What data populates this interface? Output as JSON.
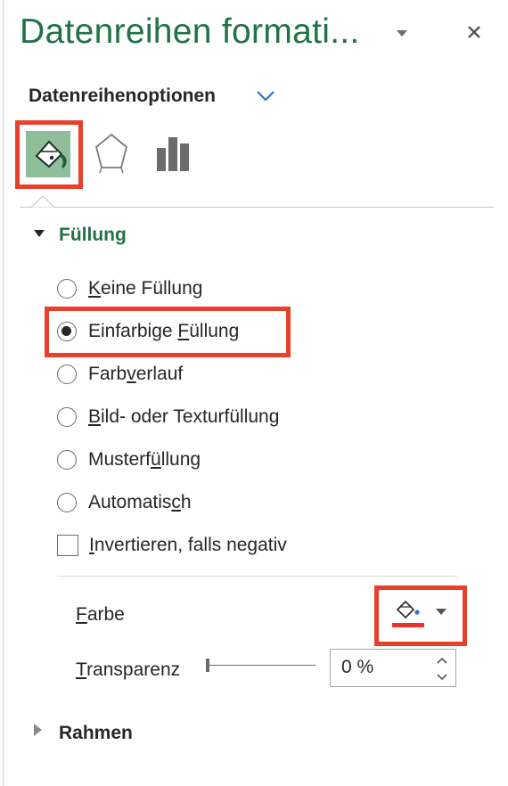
{
  "pane": {
    "title": "Datenreihen formati...",
    "dropdown_icon": "caret-down-icon",
    "close_icon": "close-icon"
  },
  "series_options": {
    "label": "Datenreihenoptionen",
    "chevron_icon": "chevron-down-icon"
  },
  "tabs": [
    {
      "name": "fill-line-tab",
      "icon": "paint-bucket-icon",
      "selected": true
    },
    {
      "name": "effects-tab",
      "icon": "pentagon-icon",
      "selected": false
    },
    {
      "name": "series-options-tab",
      "icon": "bar-chart-icon",
      "selected": false
    }
  ],
  "fill_section": {
    "title": "Füllung",
    "expanded": true,
    "options": {
      "no_fill": {
        "pre": "",
        "accel": "K",
        "post": "eine Füllung",
        "checked": false
      },
      "solid": {
        "pre": "Einfarbige ",
        "accel": "F",
        "post": "üllung",
        "checked": true
      },
      "gradient": {
        "pre": "Farb",
        "accel": "v",
        "post": "erlauf",
        "checked": false
      },
      "picture": {
        "pre": "",
        "accel": "B",
        "post": "ild- oder Texturfüllung",
        "checked": false
      },
      "pattern": {
        "pre": "Musterf",
        "accel": "ü",
        "post": "llung",
        "checked": false
      },
      "automatic": {
        "pre": "Automatis",
        "accel": "c",
        "post": "h",
        "checked": false
      }
    },
    "invert": {
      "pre": "",
      "accel": "I",
      "post": "nvertieren, falls negativ",
      "checked": false
    },
    "color": {
      "pre": "",
      "accel": "F",
      "post": "arbe",
      "swatch": "#e8322a",
      "icon": "paint-bucket-icon",
      "dropdown_icon": "caret-down-icon"
    },
    "transparency": {
      "pre": "",
      "accel": "T",
      "post": "ransparenz",
      "value_text": "0 %",
      "value": 0
    }
  },
  "border_section": {
    "title": "Rahmen",
    "expanded": false
  },
  "colors": {
    "accent": "#217346",
    "highlight": "#e8402a",
    "selected_tab": "#8fbe9b"
  }
}
